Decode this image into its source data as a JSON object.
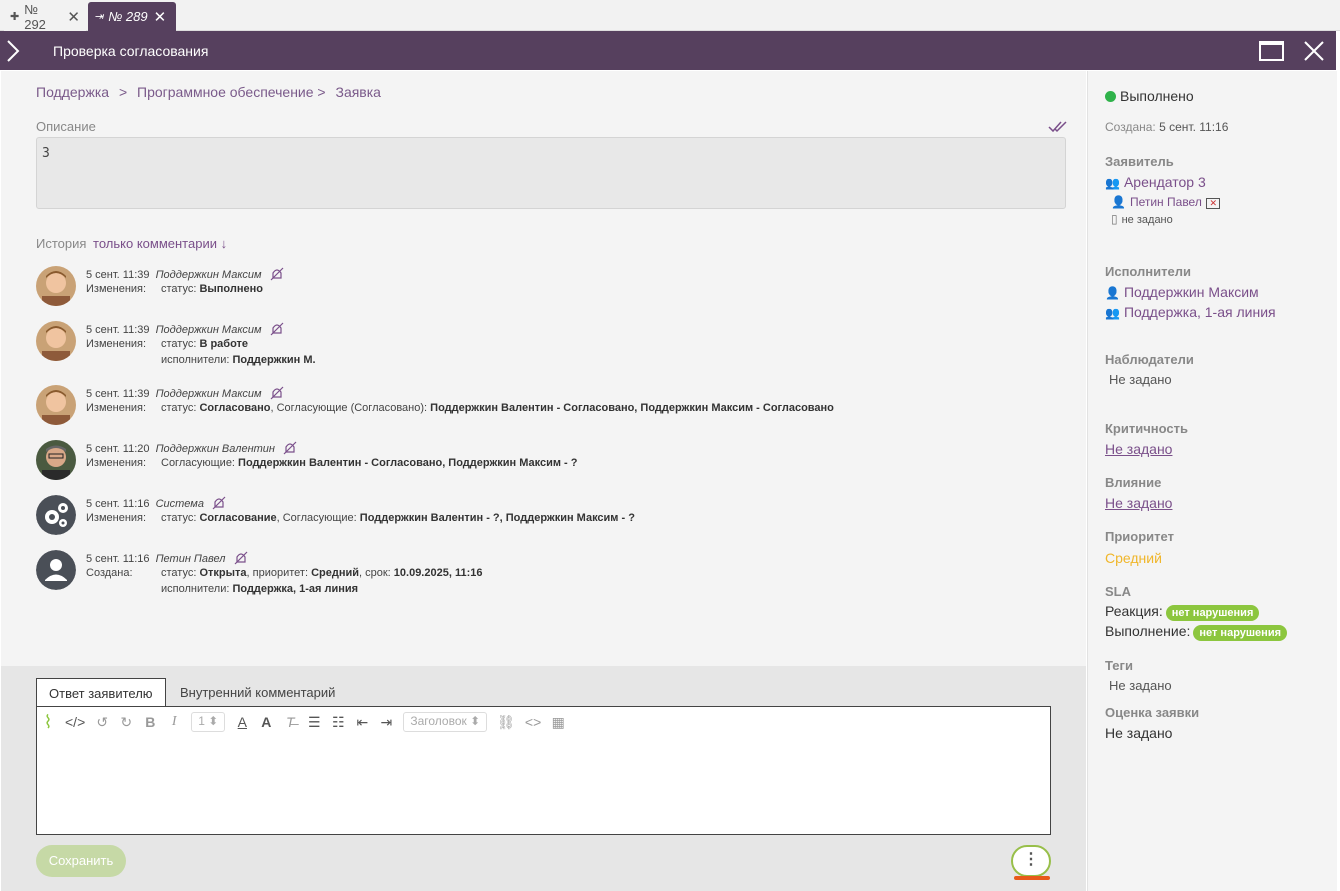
{
  "tabs": [
    {
      "pin": "⬚",
      "label": "№ 292"
    },
    {
      "pin": "⇥",
      "label": "№ 289"
    }
  ],
  "header": {
    "title": "Проверка согласования"
  },
  "breadcrumbs": [
    "Поддержка",
    ">",
    "Программное обеспечение >",
    "Заявка"
  ],
  "description": {
    "label": "Описание",
    "value": "3"
  },
  "history": {
    "label": "История",
    "filter": "только комментарии ↓"
  },
  "entries": [
    {
      "time": "5 сент. 11:39",
      "author": "Поддержкин Максим",
      "line1_key": "Изменения:",
      "line1_pre": "статус: ",
      "line1_bold": "Выполнено",
      "line1_rest": "",
      "line2_pre": "",
      "line2_bold": ""
    },
    {
      "time": "5 сент. 11:39",
      "author": "Поддержкин Максим",
      "line1_key": "Изменения:",
      "line1_pre": "статус: ",
      "line1_bold": "В работе",
      "line1_rest": "",
      "line2_pre": "исполнители: ",
      "line2_bold": "Поддержкин М."
    },
    {
      "time": "5 сент. 11:39",
      "author": "Поддержкин Максим",
      "line1_key": "Изменения:",
      "line1_pre": "статус: ",
      "line1_bold": "Согласовано",
      "line1_rest": ", Согласующие (Согласовано): ",
      "line1_bold2": "Поддержкин Валентин - Согласовано, Поддержкин Максим - Согласовано",
      "line2_pre": "",
      "line2_bold": ""
    },
    {
      "time": "5 сент. 11:20",
      "author": "Поддержкин Валентин",
      "line1_key": "Изменения:",
      "line1_pre": "Согласующие: ",
      "line1_bold": "Поддержкин Валентин - Согласовано, Поддержкин Максим - ?",
      "line1_rest": "",
      "line2_pre": "",
      "line2_bold": ""
    },
    {
      "time": "5 сент. 11:16",
      "author": "Система",
      "line1_key": "Изменения:",
      "line1_pre": "статус: ",
      "line1_bold": "Согласование",
      "line1_rest": ", Согласующие: ",
      "line1_bold2": "Поддержкин Валентин - ?, Поддержкин Максим - ?",
      "line2_pre": "",
      "line2_bold": ""
    },
    {
      "time": "5 сент. 11:16",
      "author": "Петин Павел",
      "line1_key": "Создана:",
      "line1_pre": "статус: ",
      "line1_bold": "Открыта",
      "line1_rest": ", приоритет: ",
      "line1_bold2": "Средний",
      "line1_rest2": ", срок: ",
      "line1_bold3": "10.09.2025, 11:16",
      "line2_pre": "исполнители: ",
      "line2_bold": "Поддержка, 1-ая линия"
    }
  ],
  "reply": {
    "tab_active": "Ответ заявителю",
    "tab_inactive": "Внутренний комментарий",
    "font_size": "1",
    "heading": "Заголовок",
    "save": "Сохранить",
    "more": "⋮"
  },
  "side": {
    "status": "Выполнено",
    "created_label": "Создана:",
    "created_value": "5 сент. 11:16",
    "applicant_h": "Заявитель",
    "applicant_org": "Арендатор 3",
    "applicant_person": "Петин Павел",
    "applicant_phone": "не задано",
    "executors_h": "Исполнители",
    "executor1": "Поддержкин Максим",
    "executor2": "Поддержка, 1-ая линия",
    "observers_h": "Наблюдатели",
    "observers": "Не задано",
    "criticality_h": "Критичность",
    "criticality": "Не задано",
    "impact_h": "Влияние",
    "impact": "Не задано",
    "priority_h": "Приоритет",
    "priority": "Средний",
    "sla_h": "SLA",
    "reaction_label": "Реакция:",
    "reaction_badge": "нет нарушения",
    "execution_label": "Выполнение:",
    "execution_badge": "нет нарушения",
    "tags_h": "Теги",
    "tags": "Не задано",
    "rating_h": "Оценка заявки",
    "rating": "Не задано"
  },
  "colors": {
    "header": "#56405e",
    "link": "#7a4f8a",
    "ok": "#2fb24a",
    "badge": "#8cc63e",
    "priority": "#f0b62a"
  }
}
